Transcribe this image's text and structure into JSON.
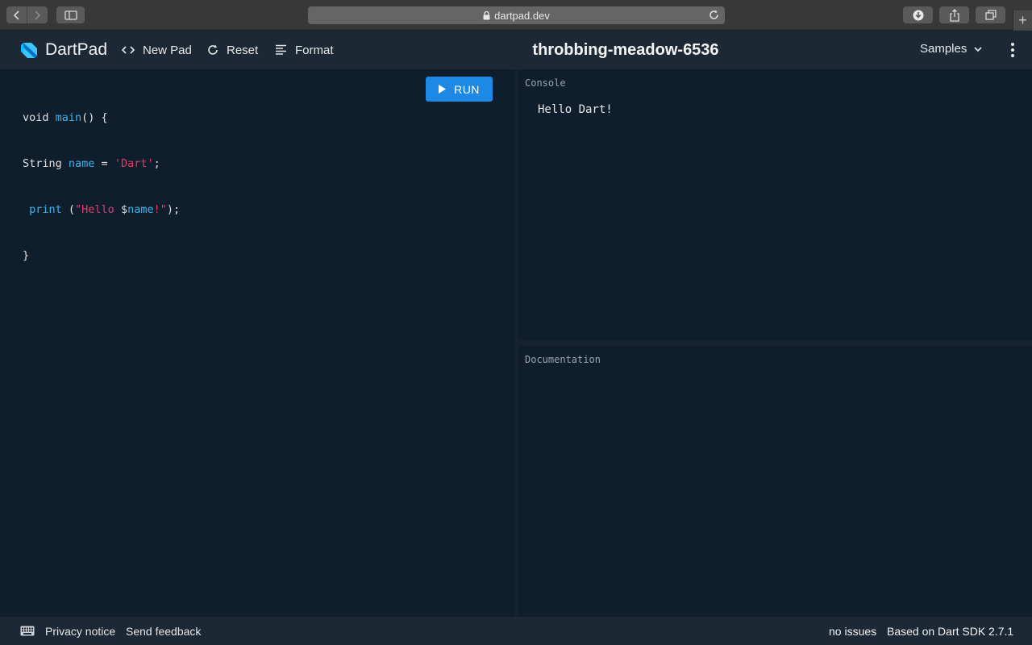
{
  "browser": {
    "url": "dartpad.dev",
    "new_tab_glyph": "+"
  },
  "header": {
    "logo_text": "DartPad",
    "new_pad_label": "New Pad",
    "reset_label": "Reset",
    "format_label": "Format",
    "pad_title": "throbbing-meadow-6536",
    "samples_label": "Samples"
  },
  "editor": {
    "run_label": "RUN",
    "code": {
      "l1_a": "void ",
      "l1_b": "main",
      "l1_c": "() {",
      "l2_a": "String ",
      "l2_b": "name",
      "l2_c": " = ",
      "l2_d": "'Dart'",
      "l2_e": ";",
      "l3_a": " ",
      "l3_b": "print",
      "l3_c": " (",
      "l3_d": "\"Hello ",
      "l3_e": "$",
      "l3_f": "name",
      "l3_g": "!\"",
      "l3_h": ");",
      "l4": "}"
    }
  },
  "console": {
    "label": "Console",
    "output": "Hello Dart!"
  },
  "docs": {
    "label": "Documentation"
  },
  "footer": {
    "privacy": "Privacy notice",
    "feedback": "Send feedback",
    "issues": "no issues",
    "sdk": "Based on Dart SDK 2.7.1"
  },
  "colors": {
    "background": "#0f1e2d",
    "header": "#1c2834",
    "run_button": "#1e88e5",
    "code_function": "#3fb3e8",
    "code_string": "#e8386a"
  }
}
